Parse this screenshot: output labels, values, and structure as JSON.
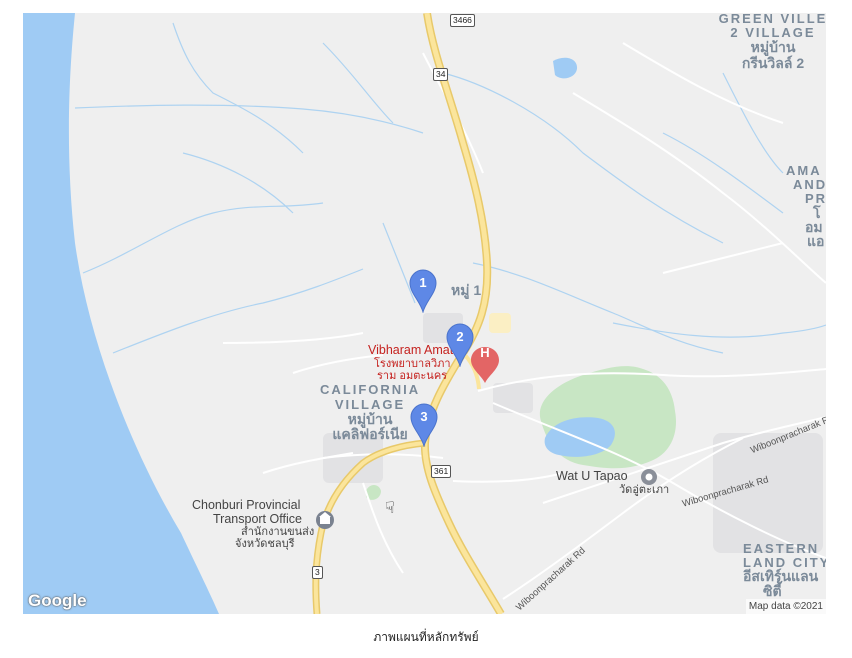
{
  "map": {
    "areas": {
      "green_ville_1": "GREEN VILLE",
      "green_ville_2": "2 VILLAGE",
      "green_ville_th1": "หมู่บ้าน",
      "green_ville_th2": "กรีนวิลล์ 2",
      "ama_1": "AMA",
      "ama_2": "AND",
      "ama_3": "PR",
      "ama_4": "โ",
      "ama_5": "อม",
      "ama_6": "แอ",
      "moo1": "หมู่ 1",
      "california_1": "CALIFORNIA",
      "california_2": "VILLAGE",
      "california_th1": "หมู่บ้าน",
      "california_th2": "แคลิฟอร์เนีย",
      "eastern_1": "EASTERN",
      "eastern_2": "LAND CITY",
      "eastern_th1": "อีสเทิร์นแลน",
      "eastern_th2": "ซิตี้"
    },
    "pois": {
      "hospital_en": "Vibharam Amata",
      "hospital_th1": "โรงพยาบาลวิภา",
      "hospital_th2": "ราม อมตะนคร",
      "hospital_icon": "H",
      "temple_en": "Wat U Tapao",
      "temple_th": "วัดอู่ตะเภา",
      "transport_en1": "Chonburi Provincial",
      "transport_en2": "Transport Office",
      "transport_th1": "สำนักงานขนส่ง",
      "transport_th2": "จังหวัดชลบุรี"
    },
    "shields": {
      "s3466": "3466",
      "s34": "34",
      "s361": "361",
      "s3": "3"
    },
    "roads": {
      "wiboon_1": "Wiboonpracharak Rd",
      "wiboon_2": "Wiboonpracharak Rd",
      "wiboon_3": "Wiboonpracharak Rd"
    },
    "markers": [
      {
        "label": "1"
      },
      {
        "label": "2"
      },
      {
        "label": "3"
      }
    ],
    "google_logo": "Google",
    "attribution": "Map data ©2021",
    "colors": {
      "water": "#9fcbf4",
      "land": "#efefef",
      "park": "#c8e6c4",
      "highway": "#f8e08e",
      "minor_road": "#ffffff",
      "stream": "#aed3f1",
      "marker": "#5e88e6",
      "hospital": "#e36565"
    },
    "cursor_icon": "hand-cursor-icon"
  },
  "caption": "ภาพแผนที่หลักทรัพย์"
}
